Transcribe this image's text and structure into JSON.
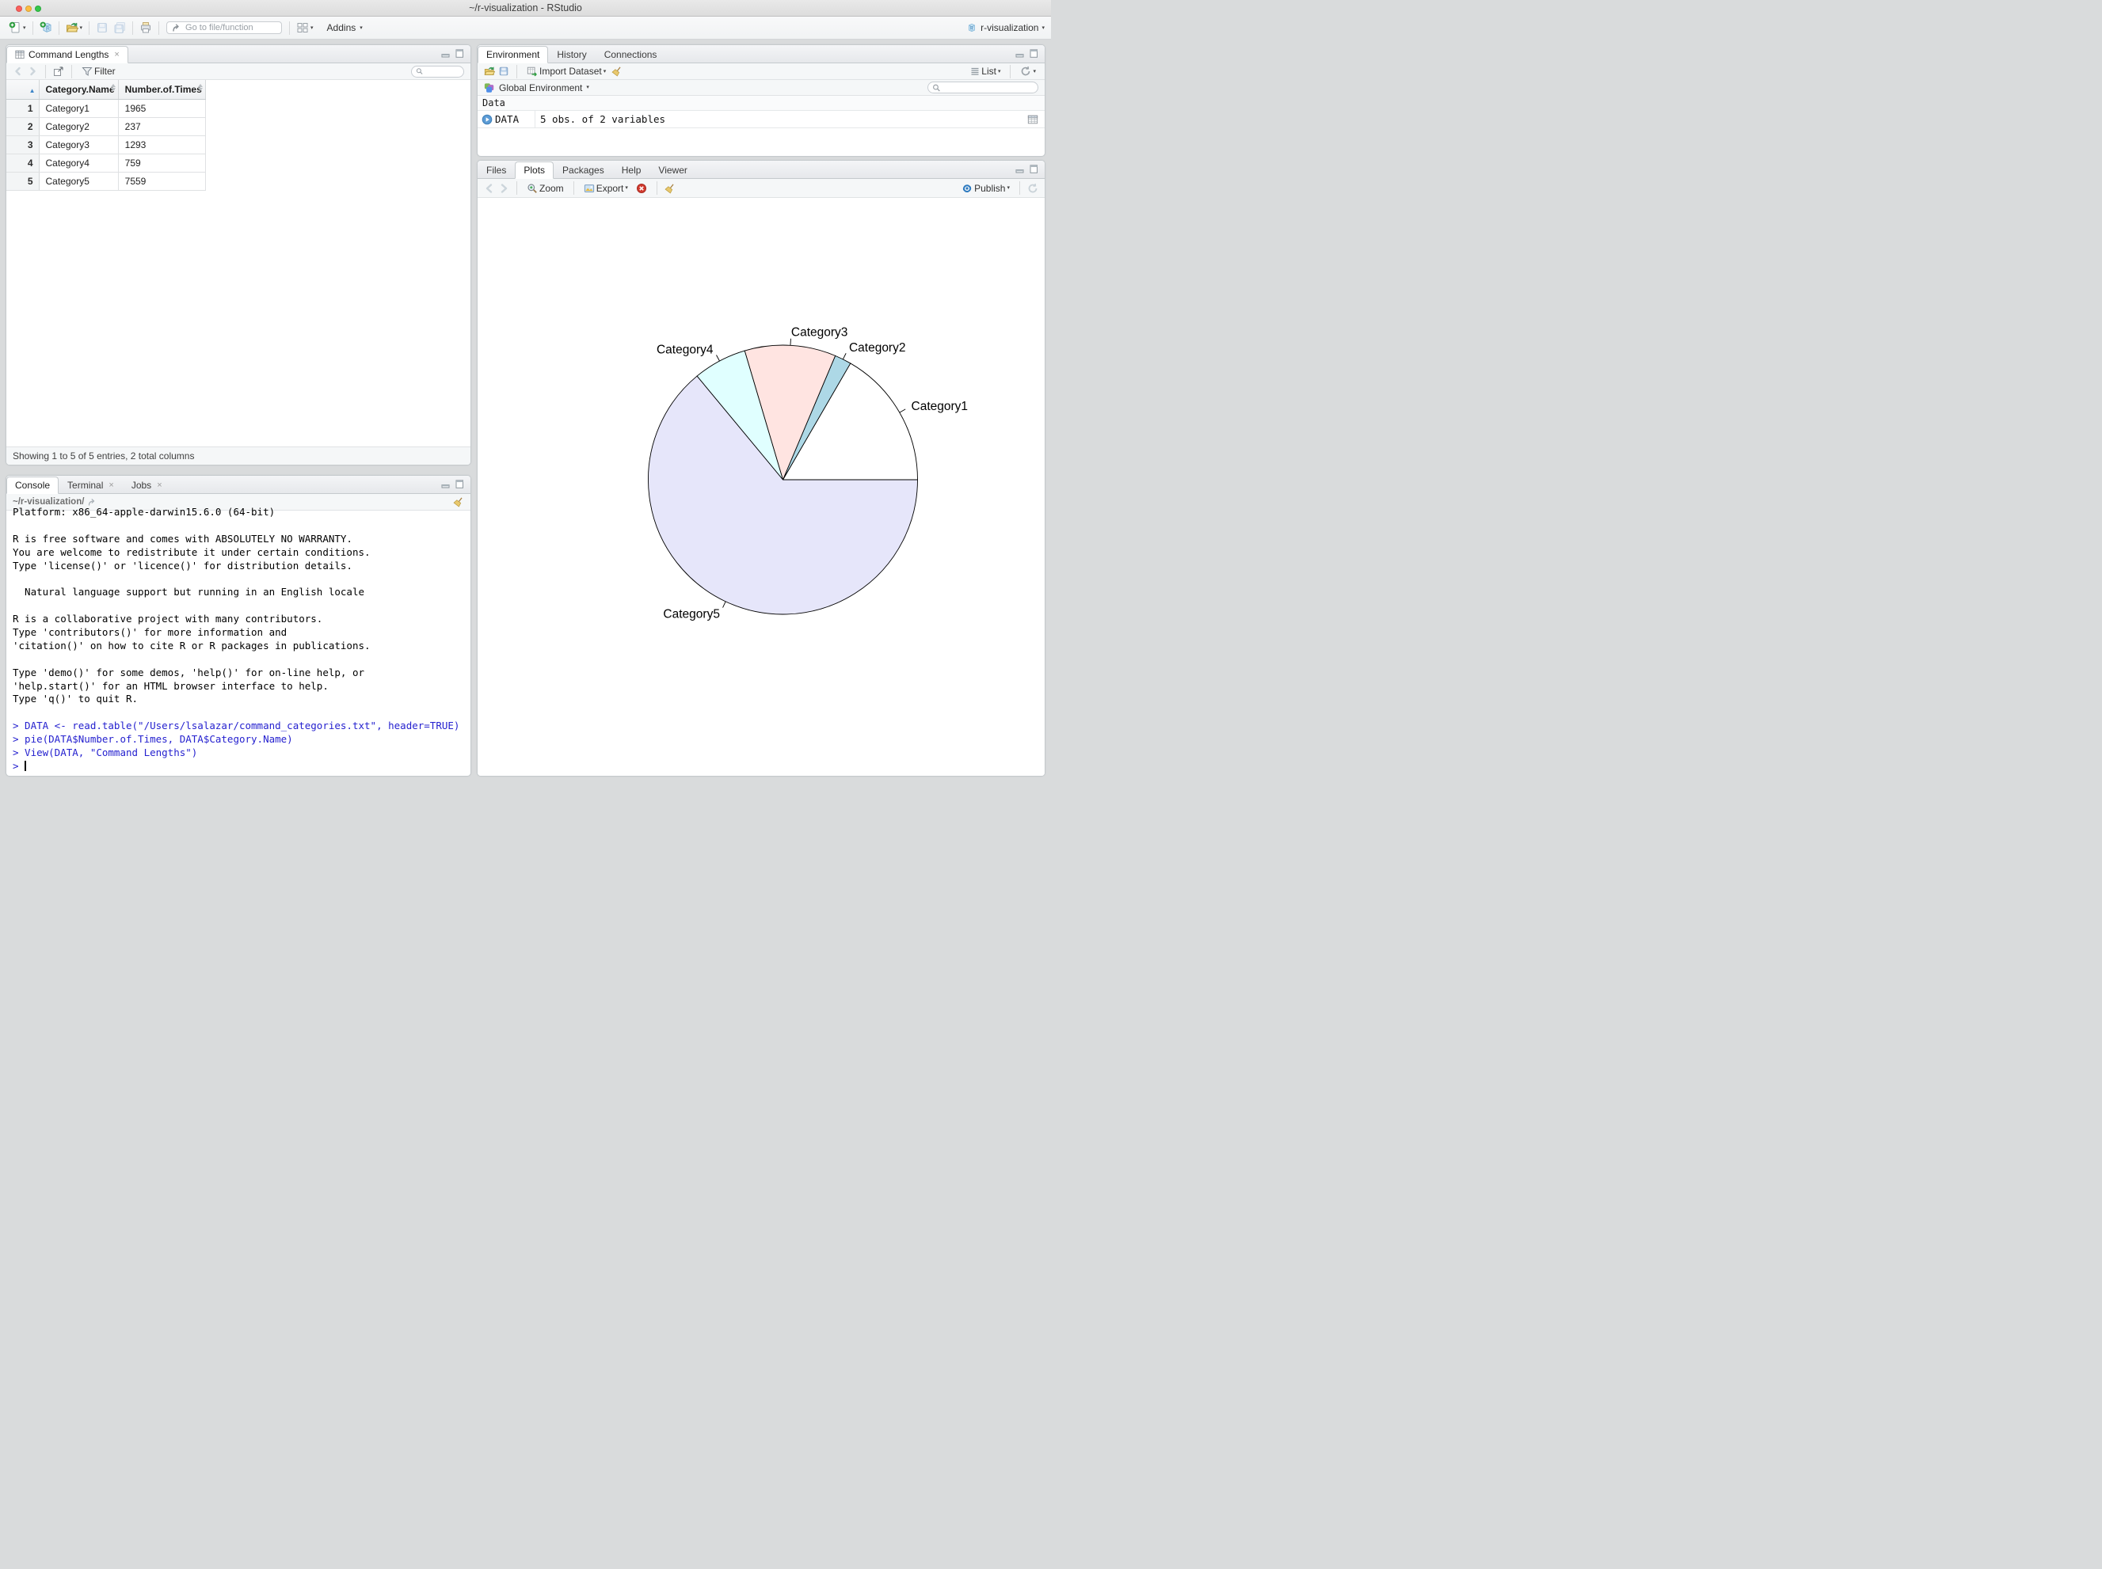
{
  "window": {
    "title": "~/r-visualization - RStudio",
    "project": "r-visualization"
  },
  "main_toolbar": {
    "goto_placeholder": "Go to file/function",
    "addins": "Addins"
  },
  "source_pane": {
    "tab": "Command Lengths",
    "filter": "Filter",
    "status": "Showing 1 to 5 of 5 entries, 2 total columns",
    "table": {
      "columns": [
        "Category.Name",
        "Number.of.Times"
      ],
      "rows": [
        [
          "Category1",
          "1965"
        ],
        [
          "Category2",
          "237"
        ],
        [
          "Category3",
          "1293"
        ],
        [
          "Category4",
          "759"
        ],
        [
          "Category5",
          "7559"
        ]
      ]
    }
  },
  "environment_pane": {
    "tabs": [
      "Environment",
      "History",
      "Connections"
    ],
    "import_dataset": "Import Dataset",
    "list": "List",
    "scope": "Global Environment",
    "section": "Data",
    "objects": [
      {
        "name": "DATA",
        "value": "5 obs. of 2 variables"
      }
    ]
  },
  "plots_pane": {
    "tabs": [
      "Files",
      "Plots",
      "Packages",
      "Help",
      "Viewer"
    ],
    "zoom": "Zoom",
    "export": "Export",
    "publish": "Publish"
  },
  "console_pane": {
    "tabs": [
      "Console",
      "Terminal",
      "Jobs"
    ],
    "working_dir": "~/r-visualization/",
    "lines": [
      {
        "t": "Platform: x86_64-apple-darwin15.6.0 (64-bit)",
        "c": "out"
      },
      {
        "t": "",
        "c": "out"
      },
      {
        "t": "R is free software and comes with ABSOLUTELY NO WARRANTY.",
        "c": "out"
      },
      {
        "t": "You are welcome to redistribute it under certain conditions.",
        "c": "out"
      },
      {
        "t": "Type 'license()' or 'licence()' for distribution details.",
        "c": "out"
      },
      {
        "t": "",
        "c": "out"
      },
      {
        "t": "  Natural language support but running in an English locale",
        "c": "out"
      },
      {
        "t": "",
        "c": "out"
      },
      {
        "t": "R is a collaborative project with many contributors.",
        "c": "out"
      },
      {
        "t": "Type 'contributors()' for more information and",
        "c": "out"
      },
      {
        "t": "'citation()' on how to cite R or R packages in publications.",
        "c": "out"
      },
      {
        "t": "",
        "c": "out"
      },
      {
        "t": "Type 'demo()' for some demos, 'help()' for on-line help, or",
        "c": "out"
      },
      {
        "t": "'help.start()' for an HTML browser interface to help.",
        "c": "out"
      },
      {
        "t": "Type 'q()' to quit R.",
        "c": "out"
      },
      {
        "t": "",
        "c": "out"
      },
      {
        "t": "> DATA <- read.table(\"/Users/lsalazar/command_categories.txt\", header=TRUE)",
        "c": "in"
      },
      {
        "t": "> pie(DATA$Number.of.Times, DATA$Category.Name)",
        "c": "in"
      },
      {
        "t": "> View(DATA, \"Command Lengths\")",
        "c": "in"
      },
      {
        "t": "> ",
        "c": "in",
        "cursor": true
      }
    ]
  },
  "chart_data": {
    "type": "pie",
    "title": "",
    "categories": [
      "Category1",
      "Category2",
      "Category3",
      "Category4",
      "Category5"
    ],
    "values": [
      1965,
      237,
      1293,
      759,
      7559
    ],
    "colors": [
      "#ffffff",
      "#add8e6",
      "#ffe4e1",
      "#e0ffff",
      "#e6e6fa"
    ],
    "border_color": "#000000",
    "start_angle_deg": 0,
    "direction": "counterclockwise",
    "labels_position": "outside-with-ticks",
    "legend": "none"
  }
}
